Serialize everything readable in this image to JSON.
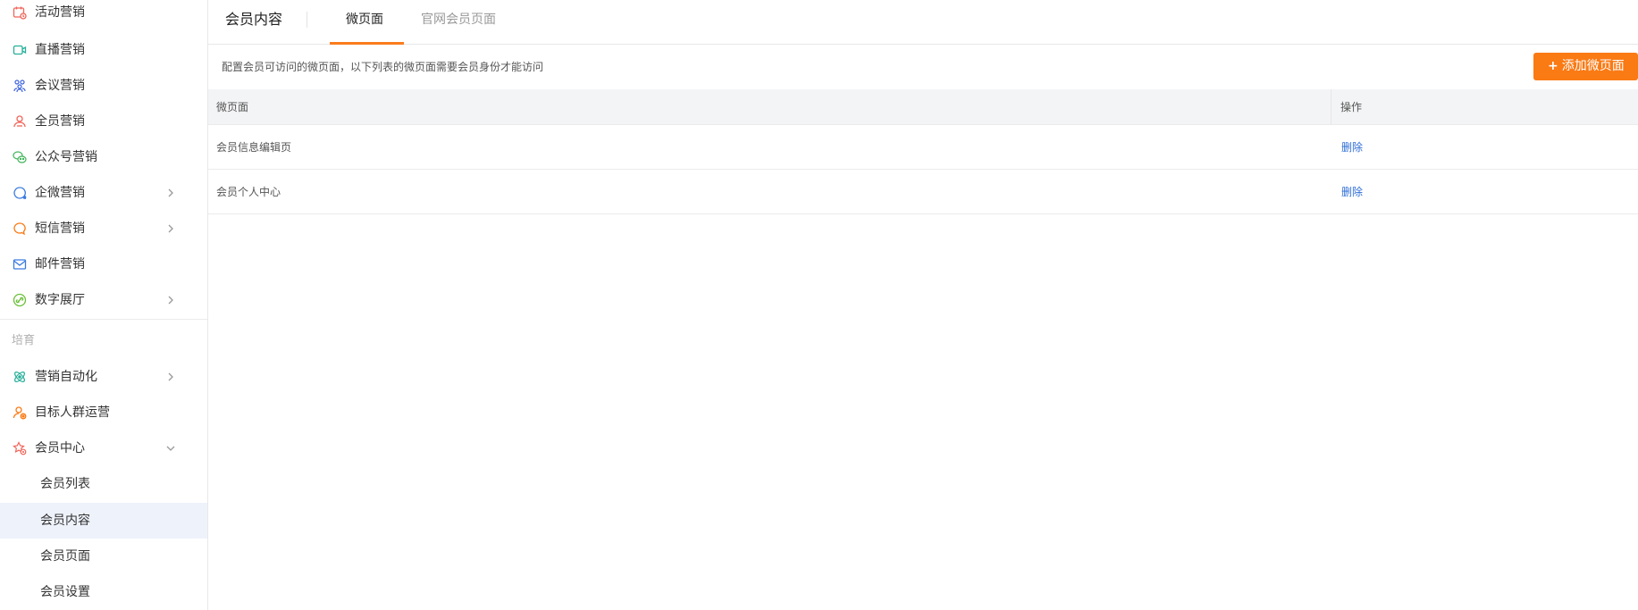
{
  "sidebar": {
    "items": [
      {
        "label": "活动营销",
        "icon": "calendar-icon",
        "color": "#f0655a",
        "arrow": false
      },
      {
        "label": "直播营销",
        "icon": "video-icon",
        "color": "#27b09a",
        "arrow": false
      },
      {
        "label": "会议营销",
        "icon": "group-icon",
        "color": "#3d63dd",
        "arrow": false
      },
      {
        "label": "全员营销",
        "icon": "users-icon",
        "color": "#f0655a",
        "arrow": false
      },
      {
        "label": "公众号营销",
        "icon": "wechat-icon",
        "color": "#3fb55a",
        "arrow": false
      },
      {
        "label": "企微营销",
        "icon": "chat-bubble-icon",
        "color": "#3a7be0",
        "arrow": true
      },
      {
        "label": "短信营销",
        "icon": "message-icon",
        "color": "#fa7a14",
        "arrow": true
      },
      {
        "label": "邮件营销",
        "icon": "mail-icon",
        "color": "#3a7be0",
        "arrow": false
      },
      {
        "label": "数字展厅",
        "icon": "link-icon",
        "color": "#6cbf3a",
        "arrow": true
      }
    ],
    "group_label": "培育",
    "group_items": [
      {
        "label": "营销自动化",
        "icon": "atom-icon",
        "color": "#27b09a",
        "arrow": "right"
      },
      {
        "label": "目标人群运营",
        "icon": "target-user-icon",
        "color": "#fa7a14",
        "arrow": "none"
      },
      {
        "label": "会员中心",
        "icon": "star-badge-icon",
        "color": "#f0655a",
        "arrow": "down"
      }
    ],
    "sub_items": [
      {
        "label": "会员列表",
        "active": false
      },
      {
        "label": "会员内容",
        "active": true
      },
      {
        "label": "会员页面",
        "active": false
      },
      {
        "label": "会员设置",
        "active": false
      }
    ]
  },
  "header": {
    "title": "会员内容",
    "tabs": [
      {
        "label": "微页面",
        "active": true
      },
      {
        "label": "官网会员页面",
        "active": false
      }
    ]
  },
  "content": {
    "hint": "配置会员可访问的微页面，以下列表的微页面需要会员身份才能访问",
    "add_button": {
      "plus": "+",
      "label": "添加微页面"
    },
    "table": {
      "columns": [
        "微页面",
        "操作"
      ],
      "rows": [
        {
          "name": "会员信息编辑页",
          "action": "删除"
        },
        {
          "name": "会员个人中心",
          "action": "删除"
        }
      ]
    }
  },
  "colors": {
    "accent": "#fa7a14",
    "link": "#2f6fd6",
    "active_bg": "#eef2fb"
  }
}
